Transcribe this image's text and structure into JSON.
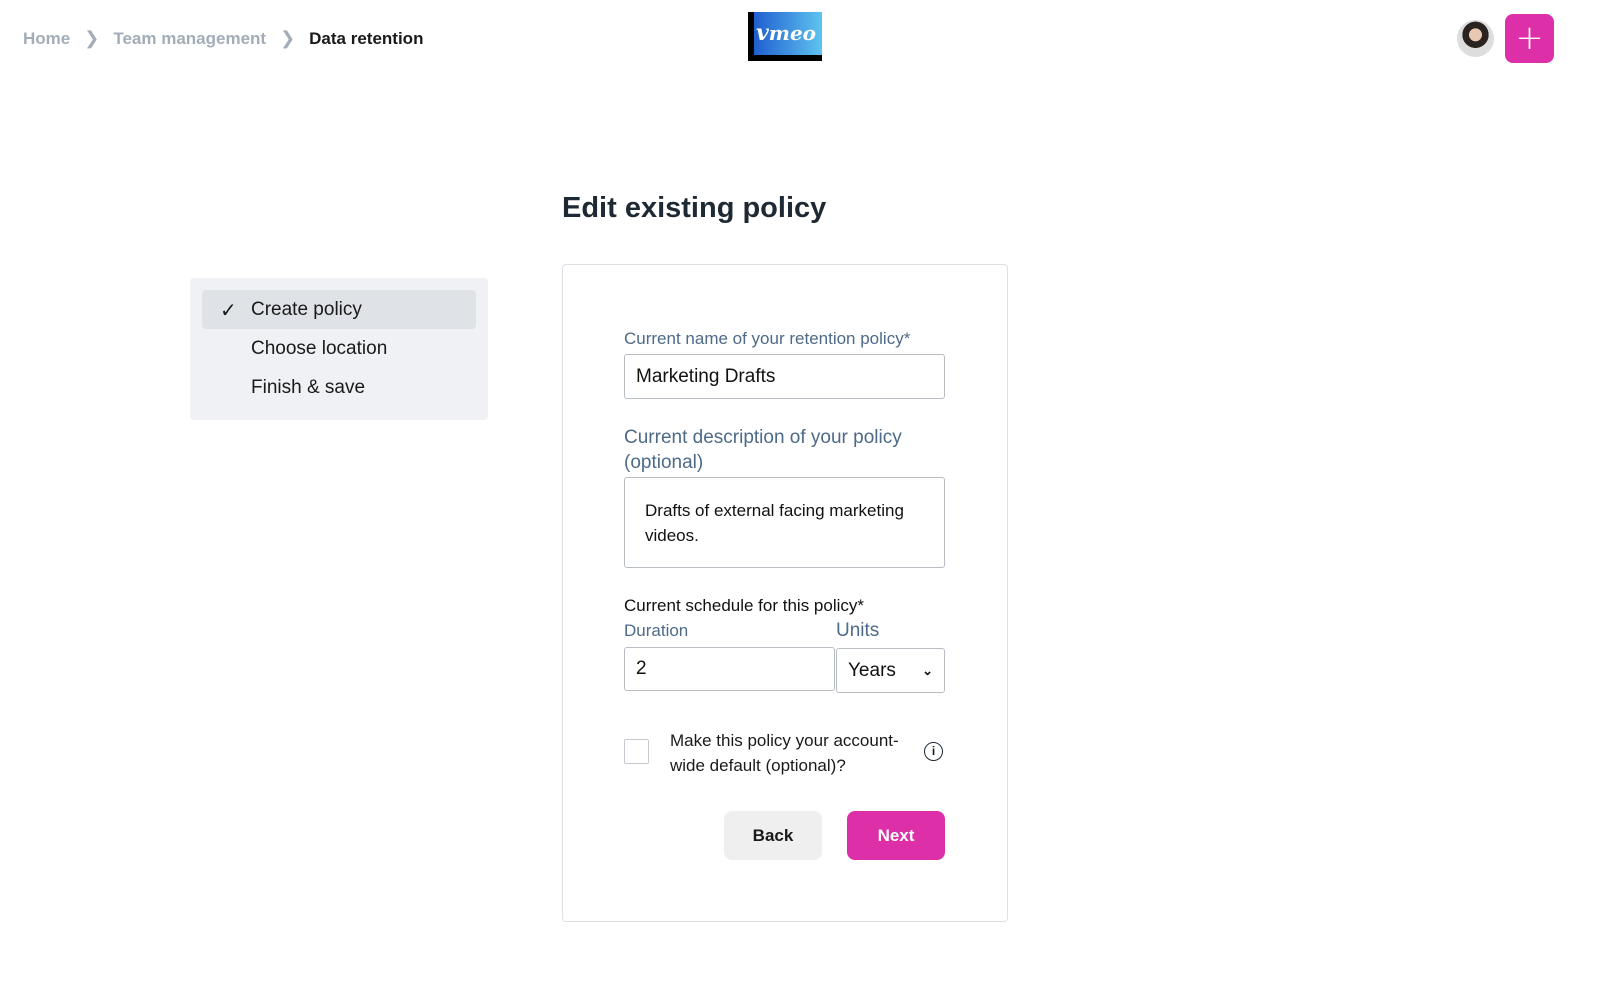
{
  "breadcrumb": {
    "items": [
      "Home",
      "Team management"
    ],
    "current": "Data retention"
  },
  "logo_text": "vimeo",
  "header": {
    "add_button_label": "+",
    "accent": "#dd2fa8"
  },
  "page_title": "Edit existing policy",
  "steps": [
    {
      "label": "Create policy",
      "done": true,
      "active": true
    },
    {
      "label": "Choose location"
    },
    {
      "label": "Finish & save"
    }
  ],
  "form": {
    "name_label": "Current name of your retention policy*",
    "name_value": "Marketing Drafts",
    "desc_label": "Current description of your policy (optional)",
    "desc_value": "Drafts of external facing marketing videos.",
    "schedule_label": "Current schedule for this policy*",
    "duration_label": "Duration",
    "duration_value": "2",
    "units_label": "Units",
    "units_value": "Years",
    "default_checkbox_label": "Make this policy your account-wide default (optional)?",
    "default_checked": false,
    "back_label": "Back",
    "next_label": "Next"
  }
}
